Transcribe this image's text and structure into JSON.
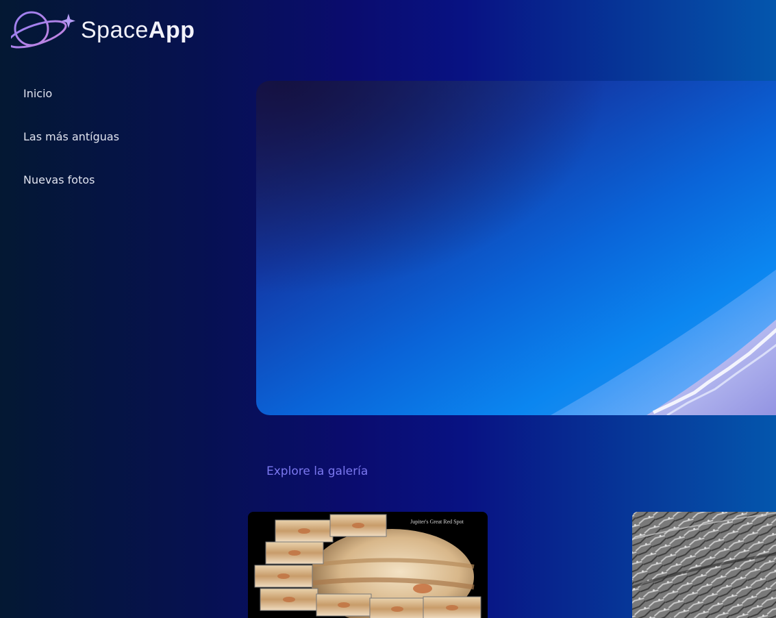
{
  "app": {
    "brand_light": "Space",
    "brand_bold": "App",
    "logo_icon": "planet-sparkle-icon"
  },
  "sidebar": {
    "items": [
      {
        "label": "Inicio"
      },
      {
        "label": "Las más antíguas"
      },
      {
        "label": "Nuevas fotos"
      }
    ]
  },
  "hero": {
    "image": "earth-horizon-from-space"
  },
  "gallery": {
    "title": "Explore la galería",
    "cards": [
      {
        "image": "jupiter-great-red-spot",
        "caption": "Jupiter's Great Red Spot"
      },
      {
        "image": "planetary-surface-grayscale"
      }
    ]
  },
  "colors": {
    "accent": "#7b78ef",
    "nav_text": "#e1e4f0",
    "logo_purple": "#b07ee0"
  }
}
